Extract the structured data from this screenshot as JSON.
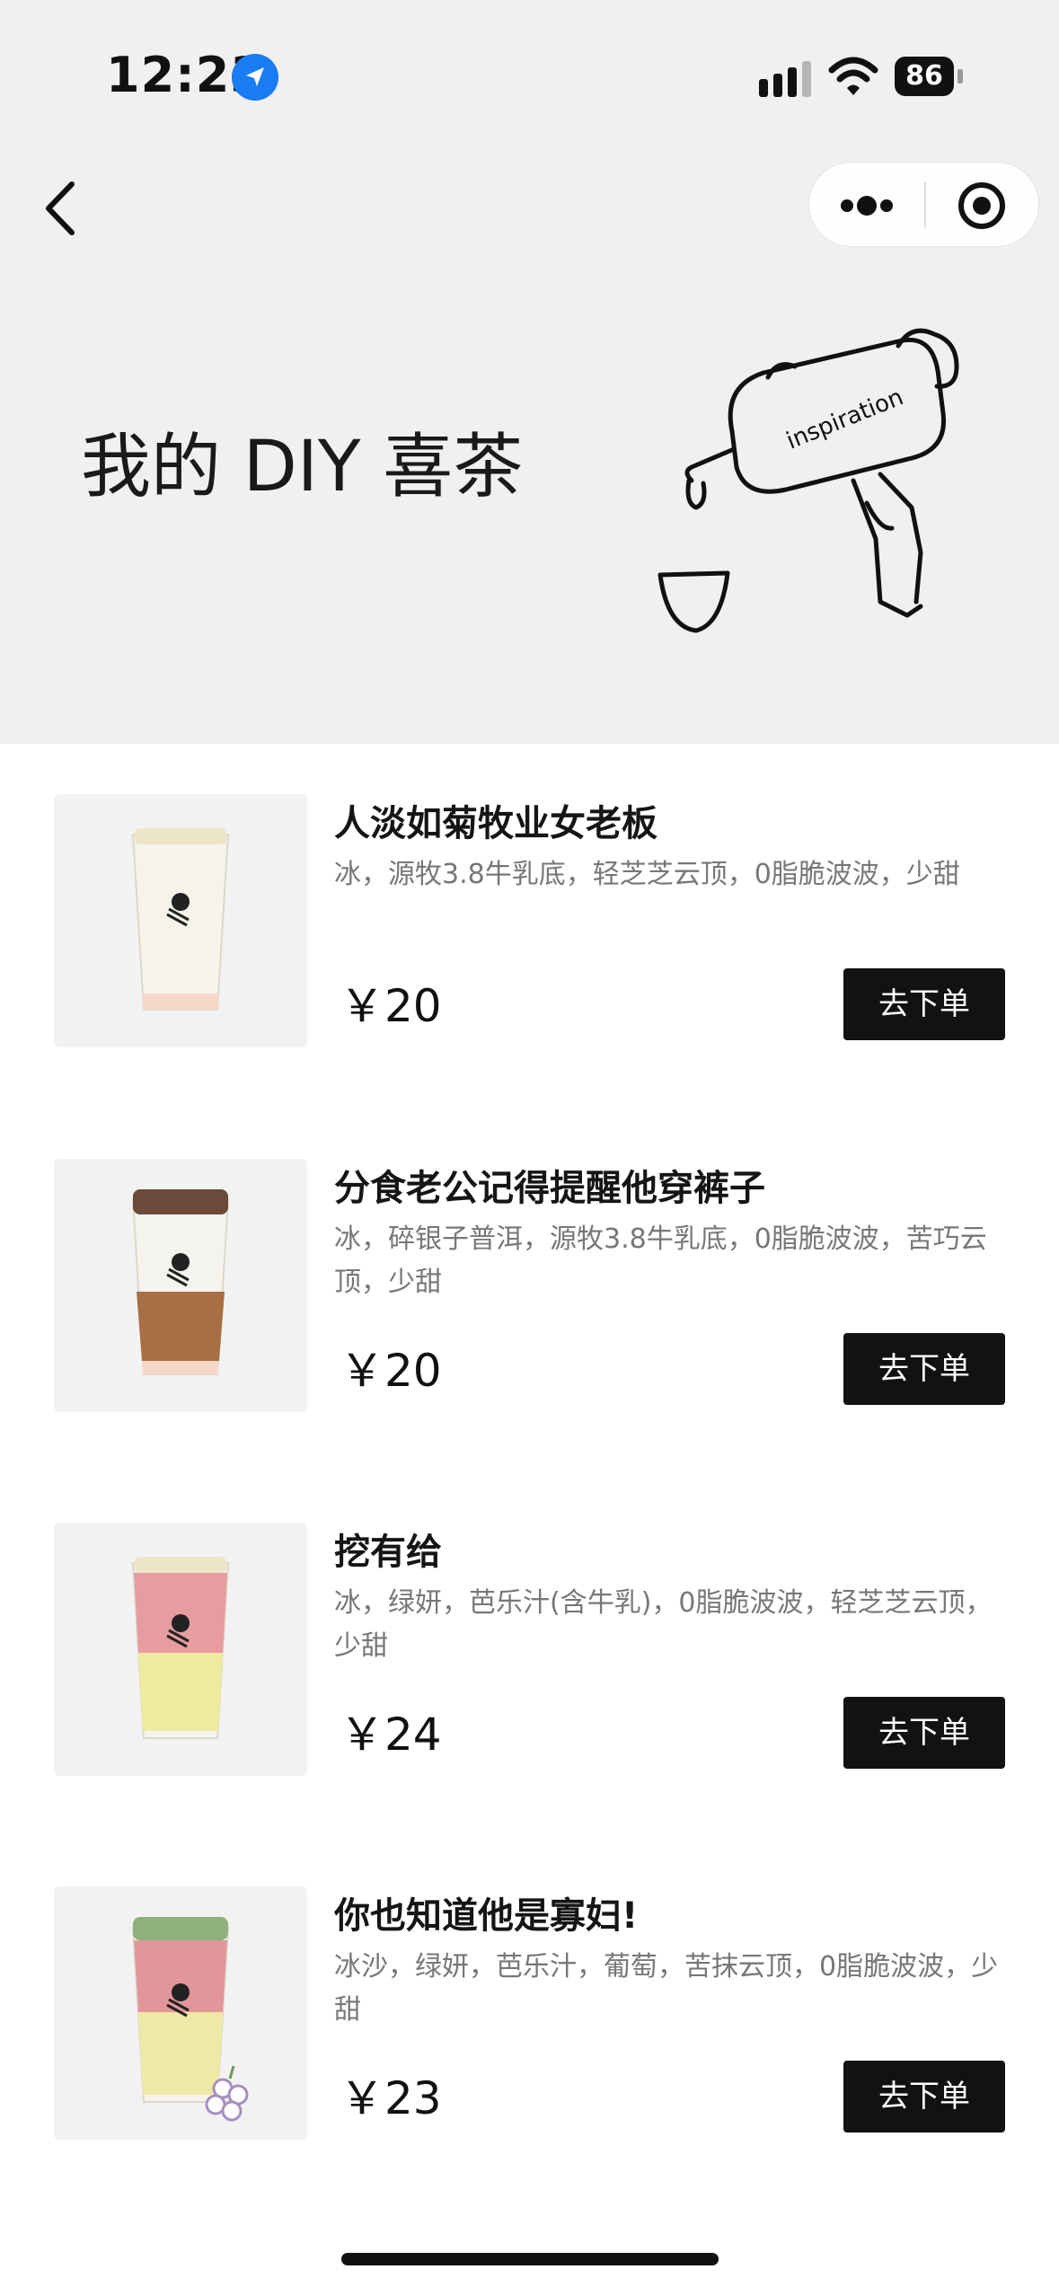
{
  "status_bar": {
    "time": "12:23",
    "battery": "86"
  },
  "header": {
    "banner_title": "我的 DIY 喜茶",
    "illustration_text": "inspiration"
  },
  "items": [
    {
      "name": "人淡如菊牧业女老板",
      "desc": "冰，源牧3.8牛乳底，轻芝芝云顶，0脂脆波波，少甜",
      "price": "￥20",
      "button": "去下单"
    },
    {
      "name": "分食老公记得提醒他穿裤子",
      "desc": "冰，碎银子普洱，源牧3.8牛乳底，0脂脆波波，苦巧云顶，少甜",
      "price": "￥20",
      "button": "去下单"
    },
    {
      "name": "挖有给",
      "desc": "冰，绿妍，芭乐汁(含牛乳)，0脂脆波波，轻芝芝云顶，少甜",
      "price": "￥24",
      "button": "去下单"
    },
    {
      "name": "你也知道他是寡妇!",
      "desc": "冰沙，绿妍，芭乐汁，葡萄，苦抹云顶，0脂脆波波，少甜",
      "price": "￥23",
      "button": "去下单"
    }
  ],
  "colors": {
    "accent": "#1a7cf2",
    "button": "#121212",
    "header_bg": "#f1f0ee"
  }
}
